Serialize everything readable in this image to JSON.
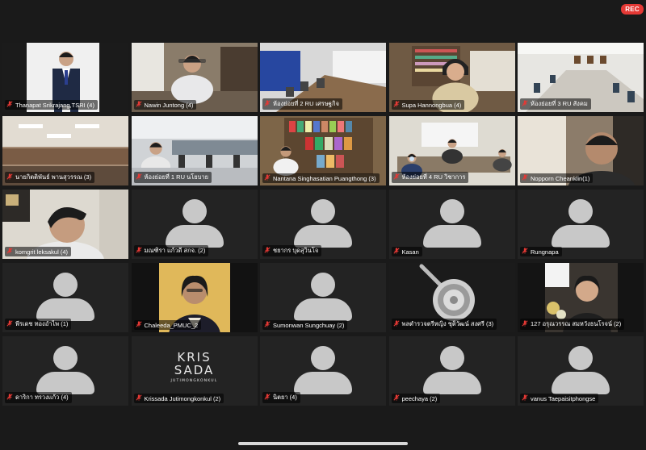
{
  "status": {
    "rec_label": "REC"
  },
  "logo": {
    "line1": "KRIS",
    "line2": "SADA",
    "line3": "JUTIMONGKONKUL"
  },
  "participants": [
    {
      "name": "Thanapat Srikrajang,TSRI (4)",
      "video": "person-standing"
    },
    {
      "name": "Nawin Juntong (4)",
      "video": "person-desk"
    },
    {
      "name": "ห้องย่อยที่ 2 RU เศรษฐกิจ",
      "video": "meeting-room-blue"
    },
    {
      "name": "Supa Hannongbua (4)",
      "video": "person-bookshelf"
    },
    {
      "name": "ห้องย่อยที่ 3 RU สังคม",
      "video": "meeting-room-wide"
    },
    {
      "name": "นายกิตติพันธ์ พานสุวรรณ (3)",
      "video": "office-ceiling"
    },
    {
      "name": "ห้องย่อยที่ 1 RU นโยบาย",
      "video": "lab-room"
    },
    {
      "name": "Nantana Singhasatian Puangthong (3)",
      "video": "person-books"
    },
    {
      "name": "ห้องย่อยที่ 4 RU วิชาการ",
      "video": "meeting-small",
      "active": true
    },
    {
      "name": "Nopporn Cheanklin(1)",
      "video": "person-closeup"
    },
    {
      "name": "komgrit leksakul (4)",
      "video": "person-looking-down"
    },
    {
      "name": "มณฑิรา แก้วดี สกจ. (2)",
      "video": "none"
    },
    {
      "name": "ชยากร บุดสุวินโจ",
      "video": "none"
    },
    {
      "name": "Kasan",
      "video": "none"
    },
    {
      "name": "Rungnapa",
      "video": "none"
    },
    {
      "name": "พีรเดช ทองอำไพ (1)",
      "video": "none"
    },
    {
      "name": "Chaleeda_PMUC_2",
      "video": "portrait-yellow"
    },
    {
      "name": "Sumonwan Sungchuay (2)",
      "video": "none"
    },
    {
      "name": "พลตำรวจตรีหญิง ชุติวัฒน์ สงศรี (3)",
      "video": "emblem"
    },
    {
      "name": "127 อรุณวรรณ สมหวังธนโรจน์ (2)",
      "video": "portrait-flowers"
    },
    {
      "name": "ดาริกา ทรวงแก้ว (4)",
      "video": "none"
    },
    {
      "name": "Krissada Jutimongkonkul (2)",
      "video": "logo"
    },
    {
      "name": "นิตยา (4)",
      "video": "none"
    },
    {
      "name": "peechaya (2)",
      "video": "none"
    },
    {
      "name": "vanus Taepaisitphongse",
      "video": "none"
    }
  ]
}
